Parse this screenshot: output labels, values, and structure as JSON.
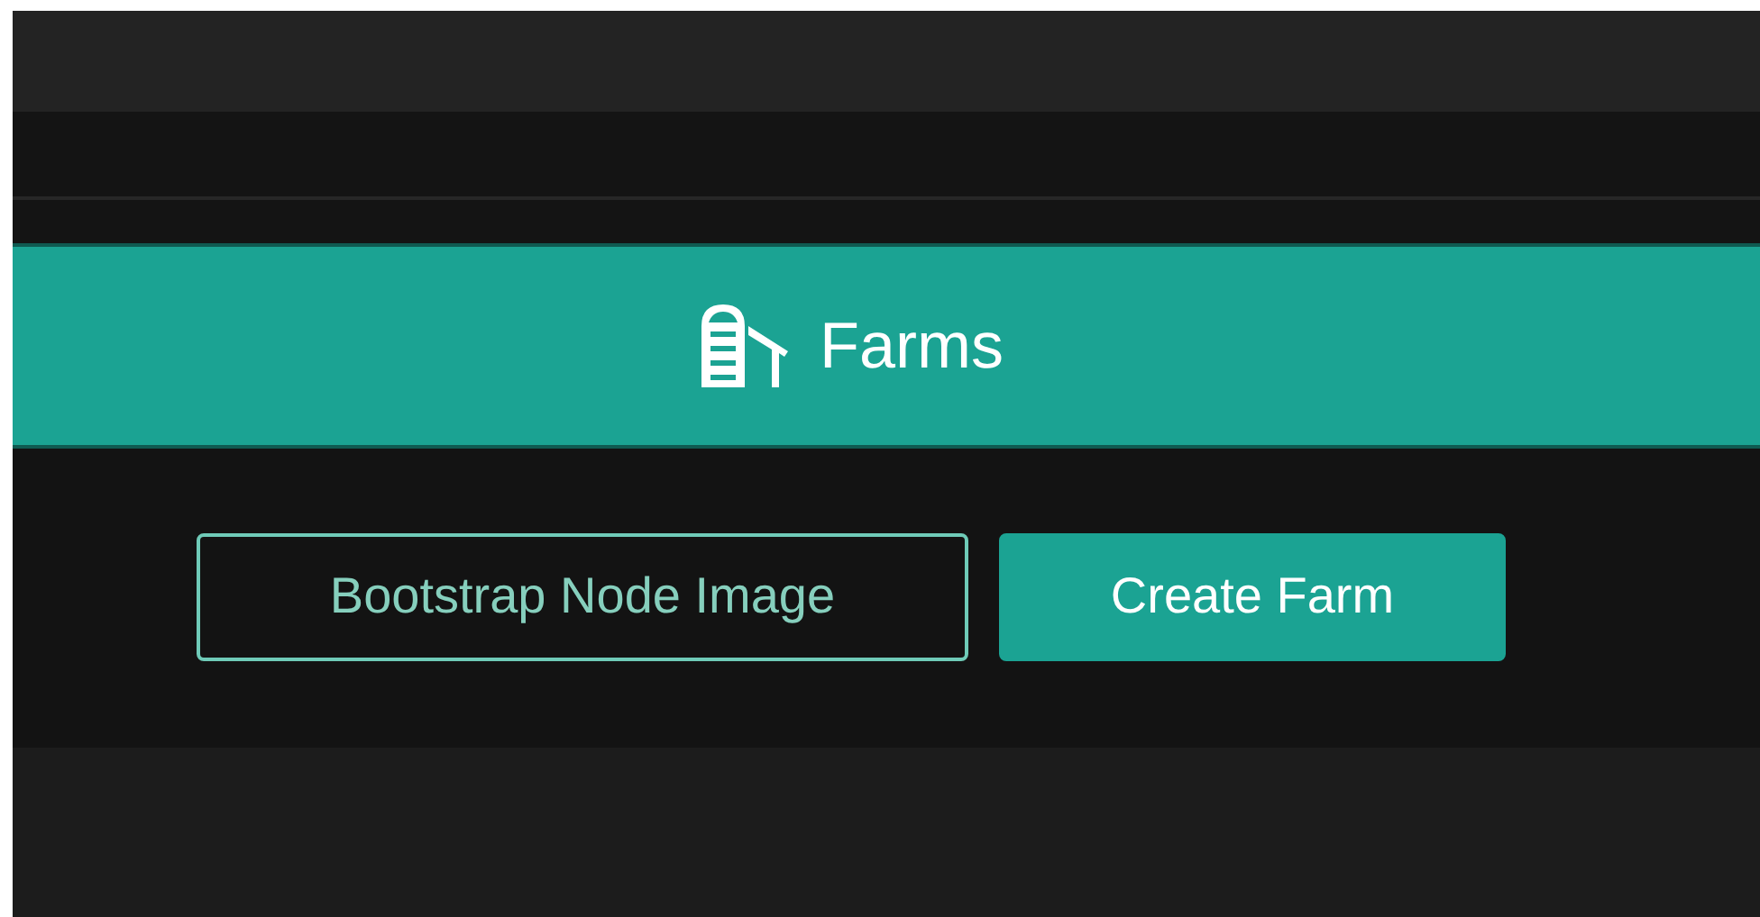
{
  "header": {
    "title": "Farms"
  },
  "actions": [
    {
      "label": "Bootstrap Node Image",
      "kind": "outline"
    },
    {
      "label": "Create Farm",
      "kind": "primary"
    }
  ]
}
